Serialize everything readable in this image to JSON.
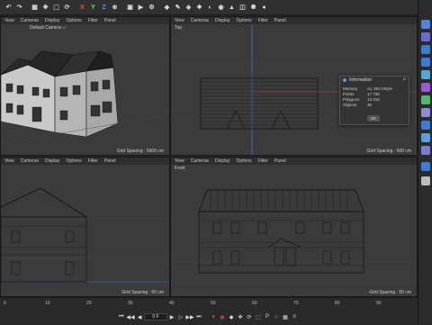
{
  "toolbar": {
    "items": [
      {
        "name": "undo-icon",
        "glyph": "↶"
      },
      {
        "name": "redo-icon",
        "glyph": "↷"
      },
      {
        "name": "select-icon",
        "glyph": "▦"
      },
      {
        "name": "move-icon",
        "glyph": "✥"
      },
      {
        "name": "scale-icon",
        "glyph": "⬚"
      },
      {
        "name": "rotate-icon",
        "glyph": "⟳"
      },
      {
        "name": "axis-x-icon",
        "glyph": "X"
      },
      {
        "name": "axis-y-icon",
        "glyph": "Y"
      },
      {
        "name": "axis-z-icon",
        "glyph": "Z"
      },
      {
        "name": "coordinate-icon",
        "glyph": "⊕"
      },
      {
        "name": "render-region-icon",
        "glyph": "▣"
      },
      {
        "name": "render-view-icon",
        "glyph": "▶"
      },
      {
        "name": "render-settings-icon",
        "glyph": "⚙"
      },
      {
        "name": "cube-icon",
        "glyph": "◆"
      },
      {
        "name": "pen-icon",
        "glyph": "✎"
      },
      {
        "name": "subdivision-icon",
        "glyph": "◈"
      },
      {
        "name": "cloner-icon",
        "glyph": "❖"
      },
      {
        "name": "deformer-icon",
        "glyph": "◐"
      },
      {
        "name": "field-icon",
        "glyph": "◉"
      },
      {
        "name": "scene-icon",
        "glyph": "▲"
      },
      {
        "name": "camera-icon",
        "glyph": "◫"
      },
      {
        "name": "light-icon",
        "glyph": "✺"
      },
      {
        "name": "sphere-icon",
        "glyph": "●"
      }
    ]
  },
  "viewports": {
    "perspective": {
      "menu": [
        "View",
        "Cameras",
        "Display",
        "Options",
        "Filter",
        "Panel"
      ],
      "title": "Default Camera ∘▫",
      "grid": "Grid Spacing : 5000 cm"
    },
    "top": {
      "menu": [
        "View",
        "Cameras",
        "Display",
        "Options",
        "Filter",
        "Panel"
      ],
      "title": "Top",
      "grid": "Grid Spacing : 500 cm"
    },
    "right": {
      "menu": [
        "View",
        "Cameras",
        "Display",
        "Options",
        "Filter",
        "Panel"
      ],
      "title": "",
      "grid": "Grid Spacing : 50 cm"
    },
    "front": {
      "menu": [
        "View",
        "Cameras",
        "Display",
        "Options",
        "Filter",
        "Panel"
      ],
      "title": "Front",
      "grid": "Grid Spacing : 50 cm"
    }
  },
  "info_dialog": {
    "title": "Information",
    "rows": [
      {
        "key": "Memory",
        "value": "ca. 853 KByte"
      },
      {
        "key": "Points",
        "value": "17 735"
      },
      {
        "key": "Polygons",
        "value": "13 316"
      },
      {
        "key": "Objects",
        "value": "30"
      }
    ],
    "ok_label": "OK"
  },
  "timeline": {
    "ticks": [
      "0",
      "10",
      "20",
      "30",
      "40",
      "50",
      "60",
      "70",
      "80",
      "90"
    ],
    "current_frame": "0 F"
  },
  "colors": {
    "accent_blue": "#3d7bd9",
    "axis_red": "#c94343",
    "grid_line": "#4a4a4a",
    "wire": "#111111"
  }
}
